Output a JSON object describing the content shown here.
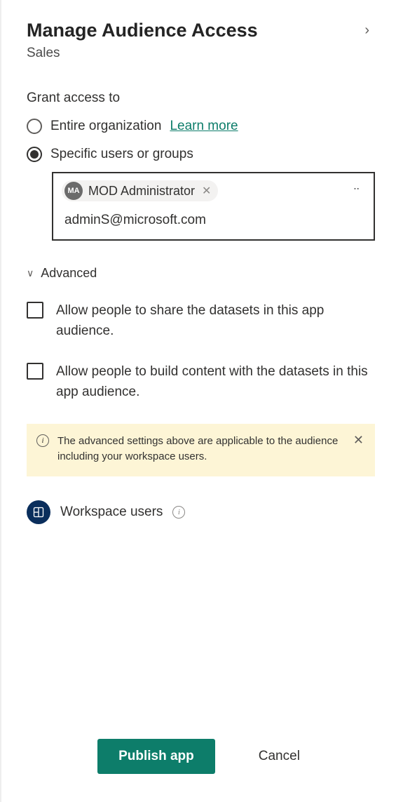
{
  "header": {
    "title": "Manage Audience Access",
    "subtitle": "Sales"
  },
  "grant": {
    "label": "Grant access to",
    "option_entire": "Entire organization",
    "learn_more": "Learn more",
    "option_specific": "Specific users or groups",
    "selected": "specific"
  },
  "picker": {
    "chip": {
      "initials": "MA",
      "name": "MOD Administrator"
    },
    "input_value": "adminS@microsoft.com"
  },
  "advanced": {
    "label": "Advanced",
    "allow_share": "Allow people to share the datasets in this app audience.",
    "allow_build": "Allow people to build content with the datasets in this app audience."
  },
  "infobar": {
    "text": "The advanced settings above are applicable to the audience including your workspace users."
  },
  "workspace": {
    "label": "Workspace users"
  },
  "footer": {
    "publish": "Publish app",
    "cancel": "Cancel"
  }
}
